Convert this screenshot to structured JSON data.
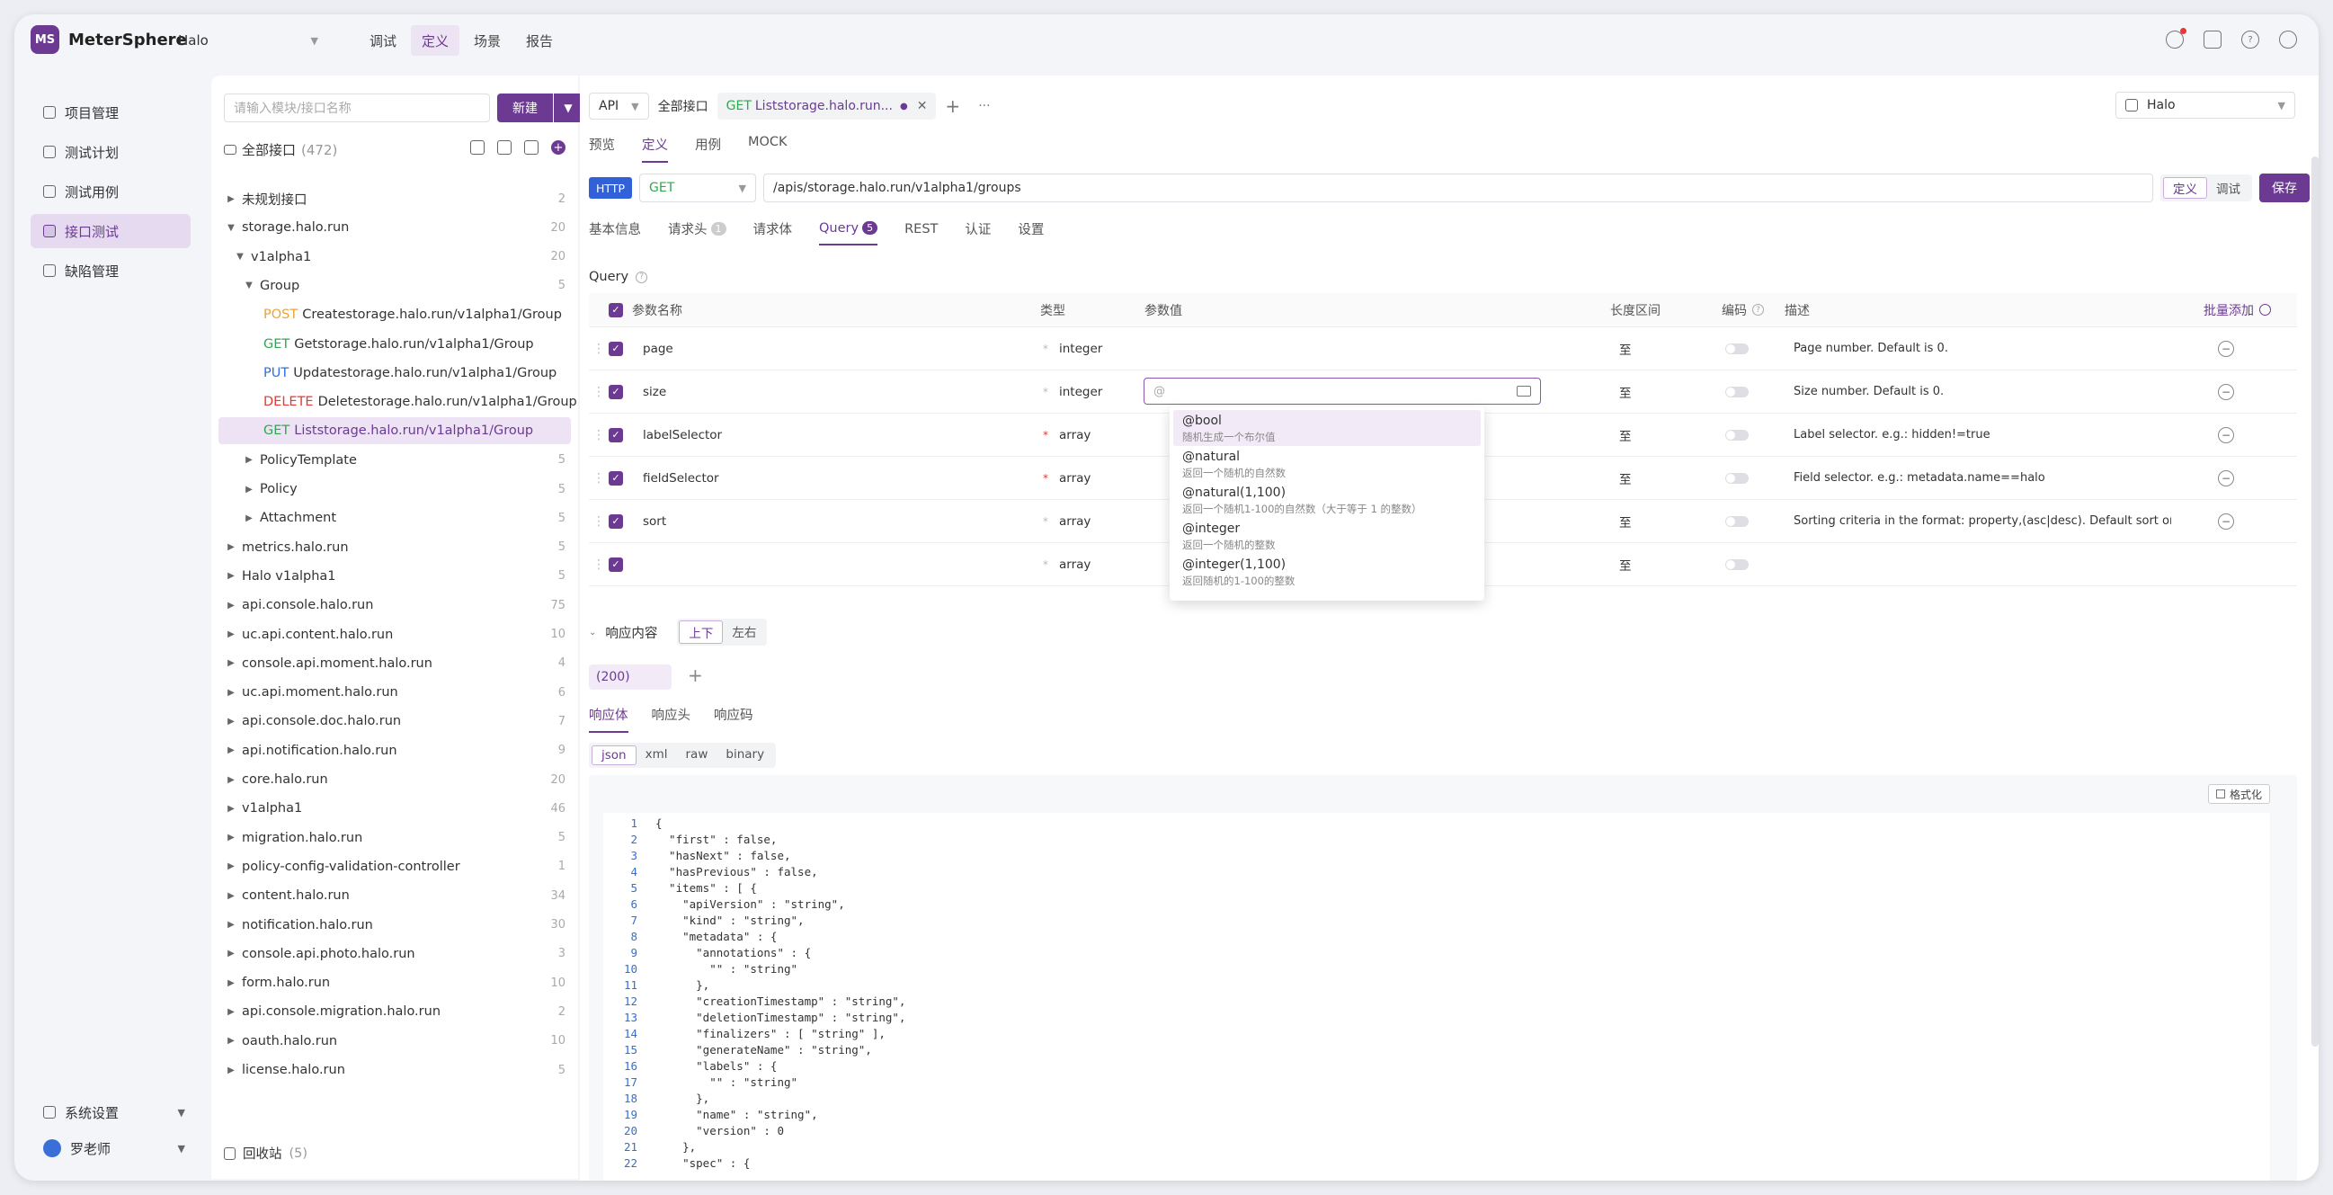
{
  "app": {
    "name": "MeterSphere",
    "logo_text": "MS",
    "project": "Halo",
    "nav": [
      "调试",
      "定义",
      "场景",
      "报告"
    ],
    "nav_active": 1
  },
  "sidebar": {
    "items": [
      "项目管理",
      "测试计划",
      "测试用例",
      "接口测试",
      "缺陷管理"
    ],
    "active": 3,
    "settings": "系统设置",
    "user": "罗老师"
  },
  "tree": {
    "search_placeholder": "请输入模块/接口名称",
    "new_label": "新建",
    "all_label": "全部接口",
    "all_count": "(472)",
    "trash_label": "回收站",
    "trash_count": "(5)",
    "nodes": [
      {
        "label": "未规划接口",
        "count": "2",
        "level": 0,
        "exp": "▶"
      },
      {
        "label": "storage.halo.run",
        "count": "20",
        "level": 0,
        "exp": "▼"
      },
      {
        "label": "v1alpha1",
        "count": "20",
        "level": 1,
        "exp": "▼"
      },
      {
        "label": "Group",
        "count": "5",
        "level": 2,
        "exp": "▼"
      },
      {
        "method": "POST",
        "label": "Createstorage.halo.run/v1alpha1/Group",
        "count": "",
        "level": 3,
        "exp": ""
      },
      {
        "method": "GET",
        "label": "Getstorage.halo.run/v1alpha1/Group",
        "count": "",
        "level": 3,
        "exp": ""
      },
      {
        "method": "PUT",
        "label": "Updatestorage.halo.run/v1alpha1/Group",
        "count": "",
        "level": 3,
        "exp": ""
      },
      {
        "method": "DELETE",
        "label": "Deletestorage.halo.run/v1alpha1/Group",
        "count": "",
        "level": 3,
        "exp": ""
      },
      {
        "method": "GET",
        "label": "Liststorage.halo.run/v1alpha1/Group",
        "count": "",
        "level": 3,
        "exp": "",
        "selected": true
      },
      {
        "label": "PolicyTemplate",
        "count": "5",
        "level": 2,
        "exp": "▶"
      },
      {
        "label": "Policy",
        "count": "5",
        "level": 2,
        "exp": "▶"
      },
      {
        "label": "Attachment",
        "count": "5",
        "level": 2,
        "exp": "▶"
      },
      {
        "label": "metrics.halo.run",
        "count": "5",
        "level": 0,
        "exp": "▶"
      },
      {
        "label": "Halo v1alpha1",
        "count": "5",
        "level": 0,
        "exp": "▶"
      },
      {
        "label": "api.console.halo.run",
        "count": "75",
        "level": 0,
        "exp": "▶"
      },
      {
        "label": "uc.api.content.halo.run",
        "count": "10",
        "level": 0,
        "exp": "▶"
      },
      {
        "label": "console.api.moment.halo.run",
        "count": "4",
        "level": 0,
        "exp": "▶"
      },
      {
        "label": "uc.api.moment.halo.run",
        "count": "6",
        "level": 0,
        "exp": "▶"
      },
      {
        "label": "api.console.doc.halo.run",
        "count": "7",
        "level": 0,
        "exp": "▶"
      },
      {
        "label": "api.notification.halo.run",
        "count": "9",
        "level": 0,
        "exp": "▶"
      },
      {
        "label": "core.halo.run",
        "count": "20",
        "level": 0,
        "exp": "▶"
      },
      {
        "label": "v1alpha1",
        "count": "46",
        "level": 0,
        "exp": "▶"
      },
      {
        "label": "migration.halo.run",
        "count": "5",
        "level": 0,
        "exp": "▶"
      },
      {
        "label": "policy-config-validation-controller",
        "count": "1",
        "level": 0,
        "exp": "▶"
      },
      {
        "label": "content.halo.run",
        "count": "34",
        "level": 0,
        "exp": "▶"
      },
      {
        "label": "notification.halo.run",
        "count": "30",
        "level": 0,
        "exp": "▶"
      },
      {
        "label": "console.api.photo.halo.run",
        "count": "3",
        "level": 0,
        "exp": "▶"
      },
      {
        "label": "form.halo.run",
        "count": "10",
        "level": 0,
        "exp": "▶"
      },
      {
        "label": "api.console.migration.halo.run",
        "count": "2",
        "level": 0,
        "exp": "▶"
      },
      {
        "label": "oauth.halo.run",
        "count": "10",
        "level": 0,
        "exp": "▶"
      },
      {
        "label": "license.halo.run",
        "count": "5",
        "level": 0,
        "exp": "▶"
      }
    ]
  },
  "main": {
    "type_select": "API",
    "all_tab": "全部接口",
    "open_tab_method": "GET",
    "open_tab_label": "Liststorage.halo.run...",
    "project_select": "Halo",
    "subtabs": [
      "预览",
      "定义",
      "用例",
      "MOCK"
    ],
    "subtab_active": 1,
    "protocol": "HTTP",
    "method": "GET",
    "url": "/apis/storage.halo.run/v1alpha1/groups",
    "mode": [
      "定义",
      "调试"
    ],
    "save": "保存",
    "req_tabs": [
      {
        "label": "基本信息",
        "badge": ""
      },
      {
        "label": "请求头",
        "badge": "1"
      },
      {
        "label": "请求体",
        "badge": ""
      },
      {
        "label": "Query",
        "badge": "5"
      },
      {
        "label": "REST",
        "badge": ""
      },
      {
        "label": "认证",
        "badge": ""
      },
      {
        "label": "设置",
        "badge": ""
      }
    ],
    "req_tab_active": 3,
    "query_title": "Query",
    "columns": {
      "name": "参数名称",
      "type": "类型",
      "value": "参数值",
      "range": "长度区间",
      "encode": "编码",
      "desc": "描述",
      "batch": "批量添加"
    },
    "rows": [
      {
        "name": "page",
        "type": "integer",
        "required": false,
        "range": "至",
        "desc": "Page number. Default is 0."
      },
      {
        "name": "size",
        "type": "integer",
        "required": false,
        "range": "至",
        "desc": "Size number. Default is 0.",
        "value": "@"
      },
      {
        "name": "labelSelector",
        "type": "array",
        "required": true,
        "range": "至",
        "desc": "Label selector. e.g.: hidden!=true"
      },
      {
        "name": "fieldSelector",
        "type": "array",
        "required": true,
        "range": "至",
        "desc": "Field selector. e.g.: metadata.name==halo"
      },
      {
        "name": "sort",
        "type": "array",
        "required": false,
        "range": "至",
        "desc": "Sorting criteria in the format: property,(asc|desc). Default sort order is asc"
      },
      {
        "name": "",
        "type": "array",
        "required": false,
        "range": "至",
        "desc": ""
      }
    ],
    "suggestions": [
      {
        "name": "@bool",
        "desc": "随机生成一个布尔值"
      },
      {
        "name": "@natural",
        "desc": "返回一个随机的自然数"
      },
      {
        "name": "@natural(1,100)",
        "desc": "返回一个随机1-100的自然数（大于等于 1 的整数）"
      },
      {
        "name": "@integer",
        "desc": "返回一个随机的整数"
      },
      {
        "name": "@integer(1,100)",
        "desc": "返回随机的1-100的整数"
      }
    ],
    "response": {
      "label": "响应内容",
      "layout": [
        "上下",
        "左右"
      ],
      "code": "(200)",
      "tabs": [
        "响应体",
        "响应头",
        "响应码"
      ],
      "formats": [
        "json",
        "xml",
        "raw",
        "binary"
      ],
      "format_btn": "格式化"
    },
    "code_lines": [
      "{",
      "  \"first\" : false,",
      "  \"hasNext\" : false,",
      "  \"hasPrevious\" : false,",
      "  \"items\" : [ {",
      "    \"apiVersion\" : \"string\",",
      "    \"kind\" : \"string\",",
      "    \"metadata\" : {",
      "      \"annotations\" : {",
      "        \"\" : \"string\"",
      "      },",
      "      \"creationTimestamp\" : \"string\",",
      "      \"deletionTimestamp\" : \"string\",",
      "      \"finalizers\" : [ \"string\" ],",
      "      \"generateName\" : \"string\",",
      "      \"labels\" : {",
      "        \"\" : \"string\"",
      "      },",
      "      \"name\" : \"string\",",
      "      \"version\" : 0",
      "    },",
      "    \"spec\" : {"
    ]
  }
}
